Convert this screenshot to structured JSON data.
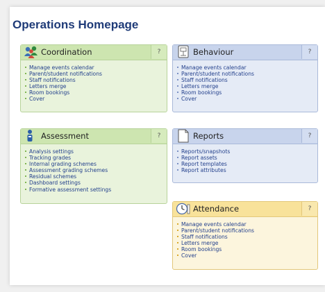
{
  "page_title": "Operations Homepage",
  "panels": {
    "coordination": {
      "title": "Coordination",
      "help": "?",
      "icon": "people-icon",
      "items": [
        "Manage events calendar",
        "Parent/student notifications",
        "Staff notifications",
        "Letters merge",
        "Room bookings",
        "Cover"
      ]
    },
    "behaviour": {
      "title": "Behaviour",
      "help": "?",
      "icon": "certificate-icon",
      "items": [
        "Manage events calendar",
        "Parent/student notifications",
        "Staff notifications",
        "Letters merge",
        "Room bookings",
        "Cover"
      ]
    },
    "assessment": {
      "title": "Assessment",
      "help": "?",
      "icon": "person-icon",
      "items": [
        "Analysis settings",
        "Tracking grades",
        "Internal grading schemes",
        "Assessment grading schemes",
        "Residual schemes",
        "Dashboard settings",
        "Formative assessment settings"
      ]
    },
    "reports": {
      "title": "Reports",
      "help": "?",
      "icon": "document-icon",
      "items": [
        "Reports/snapshots",
        "Report assets",
        "Report templates",
        "Report attributes"
      ]
    },
    "attendance": {
      "title": "Attendance",
      "help": "?",
      "icon": "clock-icon",
      "items": [
        "Manage events calendar",
        "Parent/student notifications",
        "Staff notifications",
        "Letters merge",
        "Room bookings",
        "Cover"
      ]
    }
  },
  "colors": {
    "title": "#1f3b78",
    "link": "#23408c",
    "green_header": "#cde5b0",
    "blue_header": "#c8d4ec",
    "yellow_header": "#f8e29a"
  }
}
